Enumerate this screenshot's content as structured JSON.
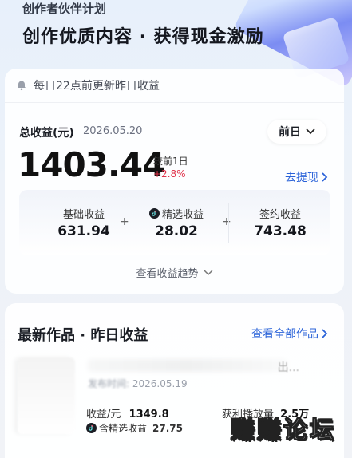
{
  "header": {
    "subtitle": "创作者伙伴计划",
    "title": "创作优质内容 · 获得现金激励"
  },
  "notice": {
    "text": "每日22点前更新昨日收益",
    "icon": "bell-icon"
  },
  "summary": {
    "label": "总收益(元)",
    "date": "2026.05.20",
    "period_selector": "前日",
    "amount": "1403.44",
    "compare_label": "较前1日",
    "compare_change": "+2.8%",
    "withdraw_label": "去提现"
  },
  "breakdown": [
    {
      "label": "基础收益",
      "value": "631.94"
    },
    {
      "label": "精选收益",
      "value": "28.02",
      "icon": "douyin-icon"
    },
    {
      "label": "签约收益",
      "value": "743.48"
    }
  ],
  "breakdown_operator": "+",
  "trend_link": "查看收益趋势",
  "works": {
    "title": "最新作品 · 昨日收益",
    "view_all": "查看全部作品",
    "ellipsis": "出...",
    "item": {
      "publish_label": "发布时间:",
      "publish_date": "2026.05.19",
      "income_label": "收益/元",
      "income_value": "1349.8",
      "featured_label": "含精选收益",
      "featured_value": "27.75",
      "plays_label": "获利播放量",
      "plays_value": "2.5万"
    }
  },
  "watermark": "赚赚论坛",
  "colors": {
    "accent": "#2a62d8",
    "positive_change": "#e0324a"
  }
}
